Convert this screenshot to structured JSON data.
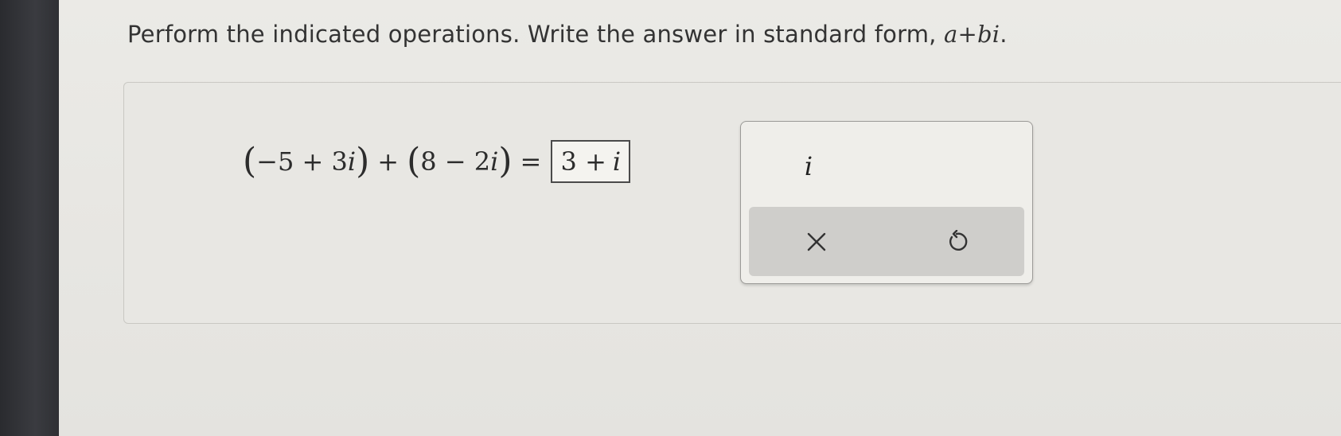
{
  "instruction": {
    "text": "Perform the indicated operations. Write the answer in standard form, ",
    "math": "a+bi",
    "period": "."
  },
  "equation": {
    "term1_open": "(",
    "term1_body_num": "−5 + 3",
    "term1_i": "i",
    "term1_close": ")",
    "operator": "+",
    "term2_open": "(",
    "term2_body_num": "8 − 2",
    "term2_i": "i",
    "term2_close": ")",
    "equals": "="
  },
  "answer": {
    "value_num": "3 +",
    "value_i": "i"
  },
  "keypad": {
    "i_key": "i",
    "clear_icon": "close-icon",
    "undo_icon": "undo-icon"
  },
  "colors": {
    "background": "#e6e5e1",
    "bezel": "#2f3034",
    "text": "#333333",
    "keypad_bar": "#cfcecb"
  }
}
